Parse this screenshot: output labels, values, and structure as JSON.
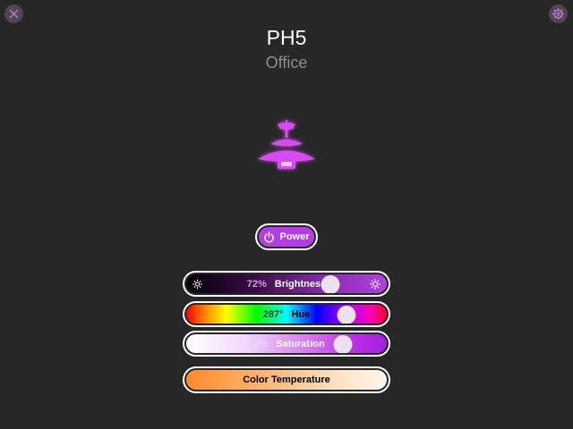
{
  "device": {
    "name": "PH5",
    "room": "Office"
  },
  "icons": {
    "close": "close-icon",
    "settings": "gear-icon",
    "lamp": "pendant-lamp-icon",
    "power": "power-icon",
    "sun": "sun-icon"
  },
  "colors": {
    "accent": "#b43ee3",
    "background": "#272727",
    "lamp_glow": "#d94cf2"
  },
  "power": {
    "label": "Power",
    "on": true
  },
  "brightness": {
    "value_text": "72%",
    "label": "Brightness",
    "value": 0.72
  },
  "hue": {
    "value_text": "287°",
    "label": "Hue",
    "value": 287
  },
  "saturation": {
    "value_text": "78%",
    "label": "Saturation",
    "value": 0.78
  },
  "color_temperature": {
    "label": "Color Temperature"
  }
}
